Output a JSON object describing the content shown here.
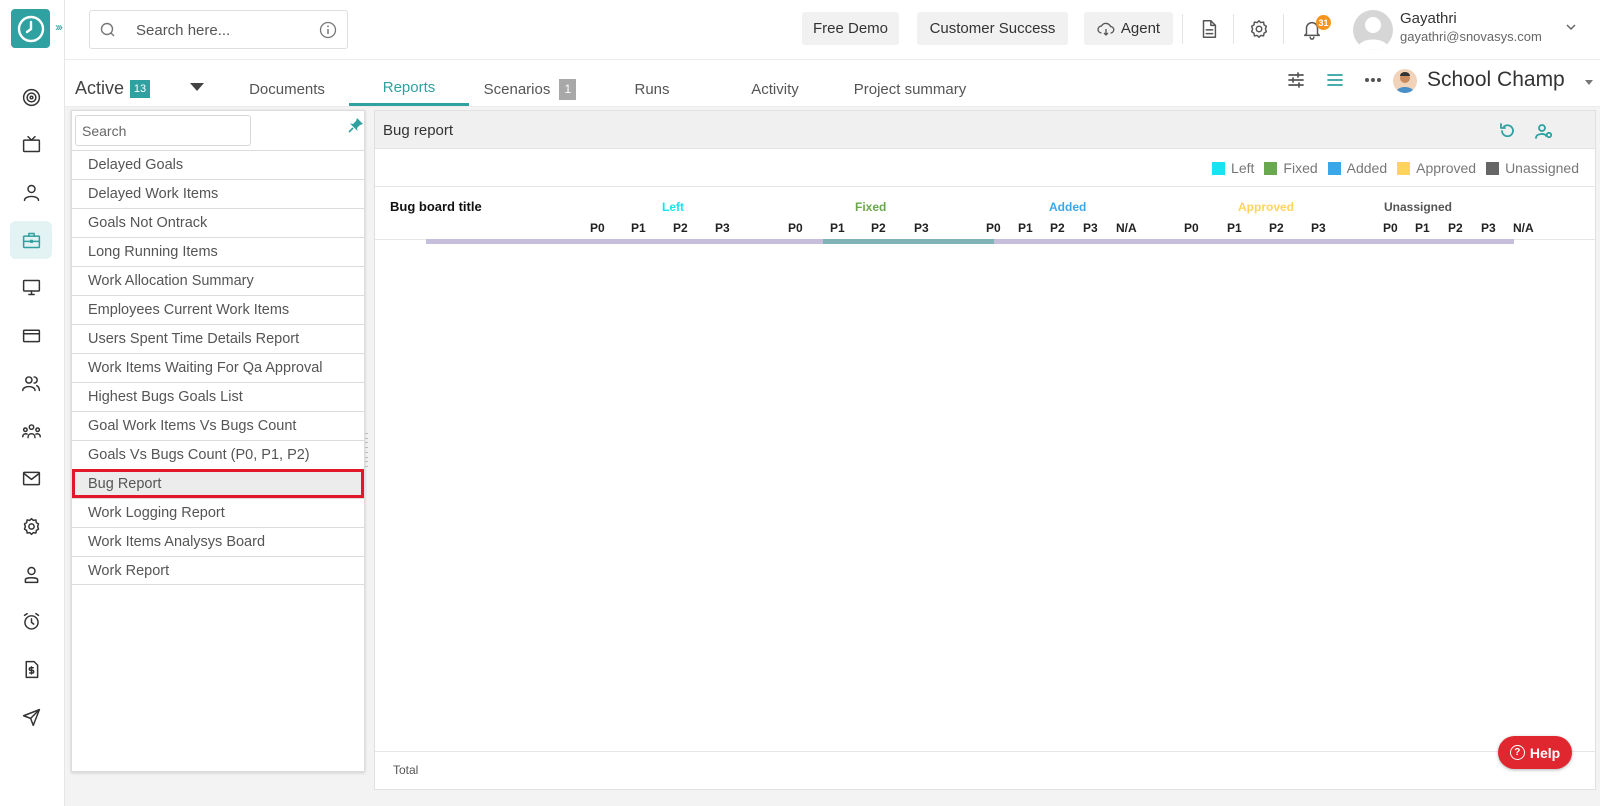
{
  "search": {
    "placeholder": "Search here..."
  },
  "topbar": {
    "free_demo": "Free Demo",
    "customer_success": "Customer Success",
    "agent": "Agent",
    "notification_count": "31"
  },
  "user": {
    "name": "Gayathri",
    "email": "gayathri@snovasys.com"
  },
  "subbar": {
    "active_label": "Active",
    "active_count": "13",
    "tabs": [
      {
        "label": "Documents"
      },
      {
        "label": "Reports"
      },
      {
        "label": "Scenarios",
        "count": "1"
      },
      {
        "label": "Runs"
      },
      {
        "label": "Activity"
      },
      {
        "label": "Project summary"
      }
    ],
    "project_name": "School Champ"
  },
  "reports_panel": {
    "search_placeholder": "Search",
    "items": [
      "Delayed Goals",
      "Delayed Work Items",
      "Goals Not Ontrack",
      "Long Running Items",
      "Work Allocation Summary",
      "Employees Current Work Items",
      "Users Spent Time Details Report",
      "Work Items Waiting For Qa Approval",
      "Highest Bugs Goals List",
      "Goal Work Items Vs Bugs Count",
      "Goals Vs Bugs Count (P0, P1, P2)",
      "Bug Report",
      "Work Logging Report",
      "Work Items Analysys Board",
      "Work Report"
    ],
    "selected": "Bug Report"
  },
  "viewer": {
    "title": "Bug report",
    "legend": [
      {
        "label": "Left",
        "color": "#18e3f0"
      },
      {
        "label": "Fixed",
        "color": "#69a84f"
      },
      {
        "label": "Added",
        "color": "#3aa8e8"
      },
      {
        "label": "Approved",
        "color": "#ffd45c"
      },
      {
        "label": "Unassigned",
        "color": "#666666"
      }
    ],
    "board_title_label": "Bug board title",
    "groups": [
      {
        "label": "Left",
        "color": "#18e3f0",
        "priorities": [
          "P0",
          "P1",
          "P2",
          "P3"
        ]
      },
      {
        "label": "Fixed",
        "color": "#69a84f",
        "priorities": [
          "P0",
          "P1",
          "P2",
          "P3"
        ]
      },
      {
        "label": "Added",
        "color": "#3aa8e8",
        "priorities": [
          "P0",
          "P1",
          "P2",
          "P3",
          "N/A"
        ]
      },
      {
        "label": "Approved",
        "color": "#ffd45c",
        "priorities": [
          "P0",
          "P1",
          "P2",
          "P3"
        ]
      },
      {
        "label": "Unassigned",
        "color": "#555555",
        "priorities": [
          "P0",
          "P1",
          "P2",
          "P3",
          "N/A"
        ]
      }
    ],
    "total_label": "Total"
  },
  "help": {
    "label": "Help"
  }
}
